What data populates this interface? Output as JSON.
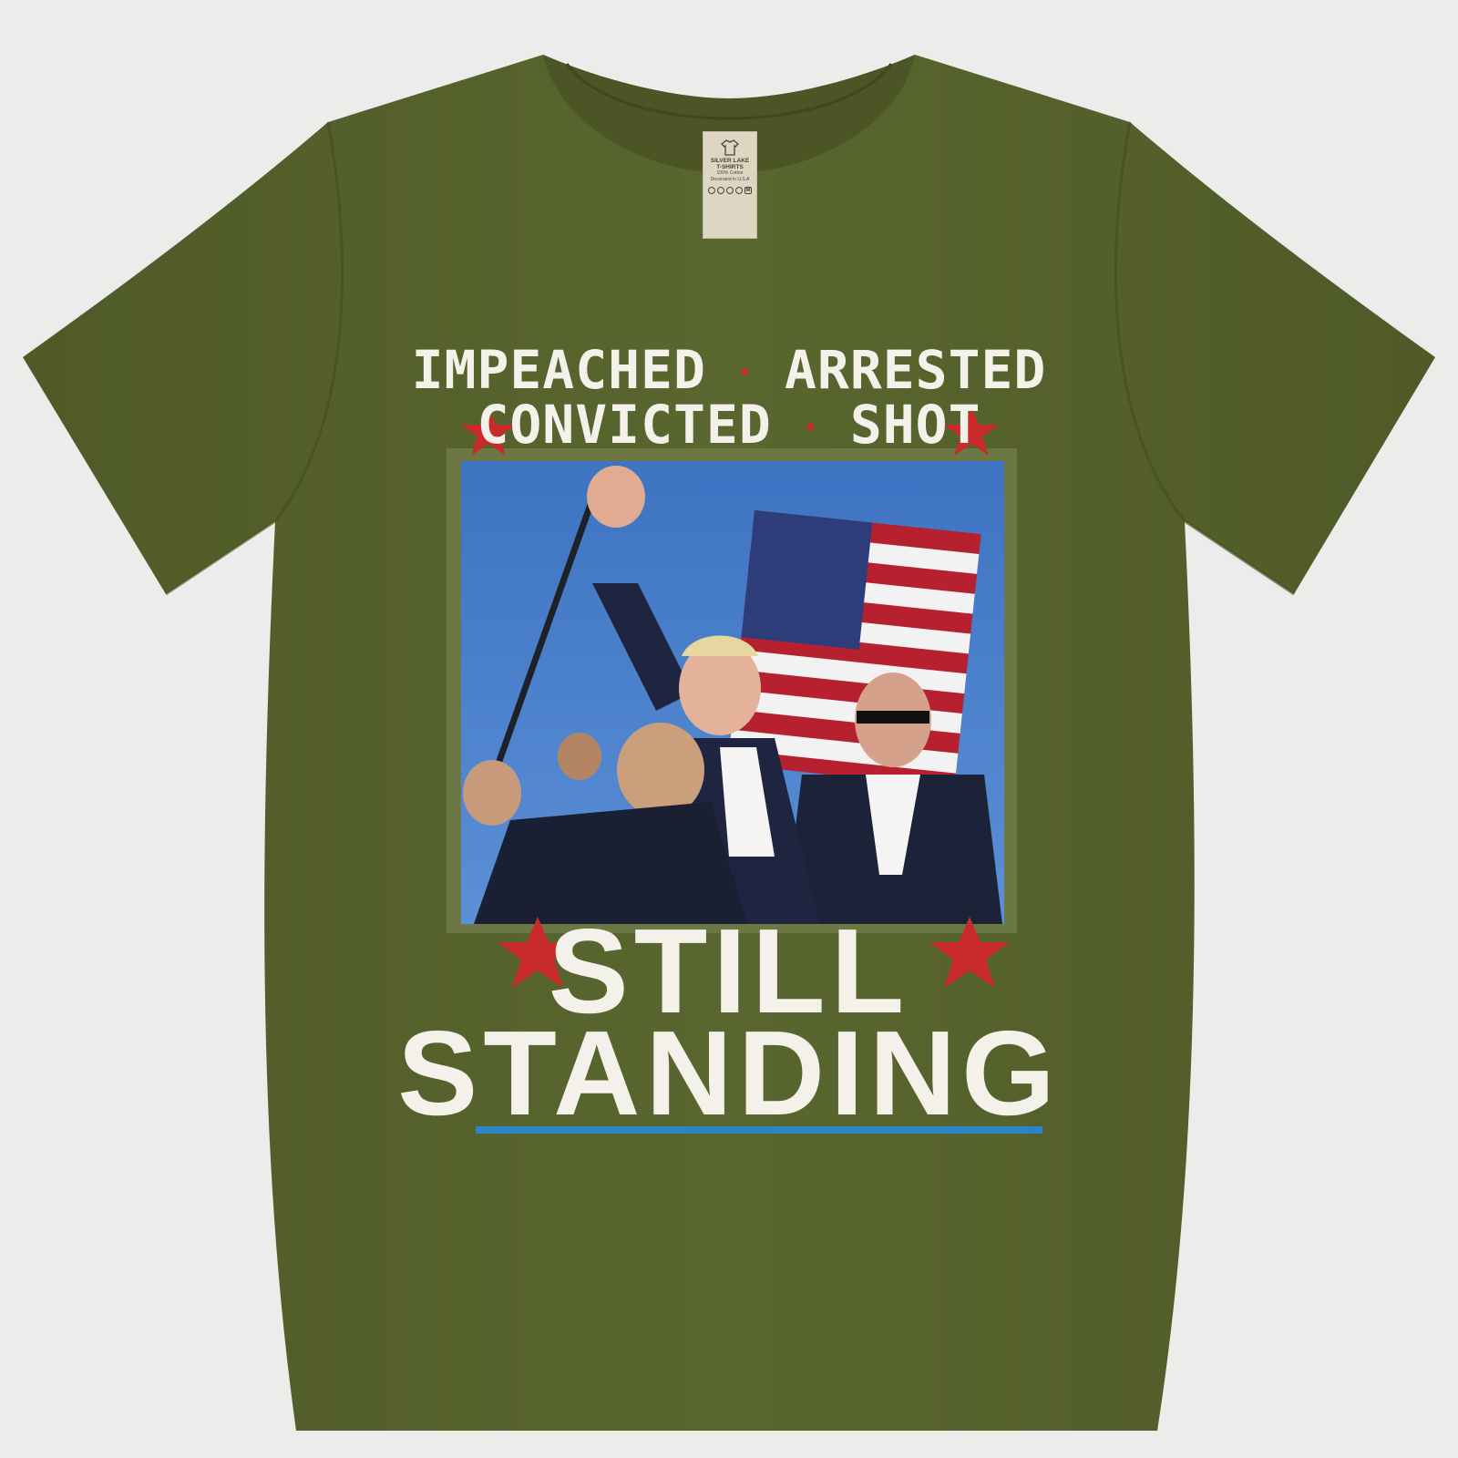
{
  "image": {
    "subject": "olive green t-shirt with printed graphic",
    "colors": {
      "background": "#ececea",
      "shirt": "#57632d",
      "text": "#f4f1ea",
      "stars": "#c92a2a",
      "rule": "#2a86c6",
      "sky": "#3f77c4"
    }
  },
  "neck_label": {
    "brand": "SILVER LAKE",
    "brand_sub": "T-SHIRTS",
    "material": "100% Cotton",
    "origin": "Decorated in U.S.A",
    "size": "M"
  },
  "print": {
    "line1_left": "IMPEACHED",
    "line1_right": "ARRESTED",
    "line2_left": "CONVICTED",
    "line2_right": "SHOT",
    "separator": "•",
    "headline_big_1": "STILL",
    "headline_big_2": "STANDING"
  }
}
